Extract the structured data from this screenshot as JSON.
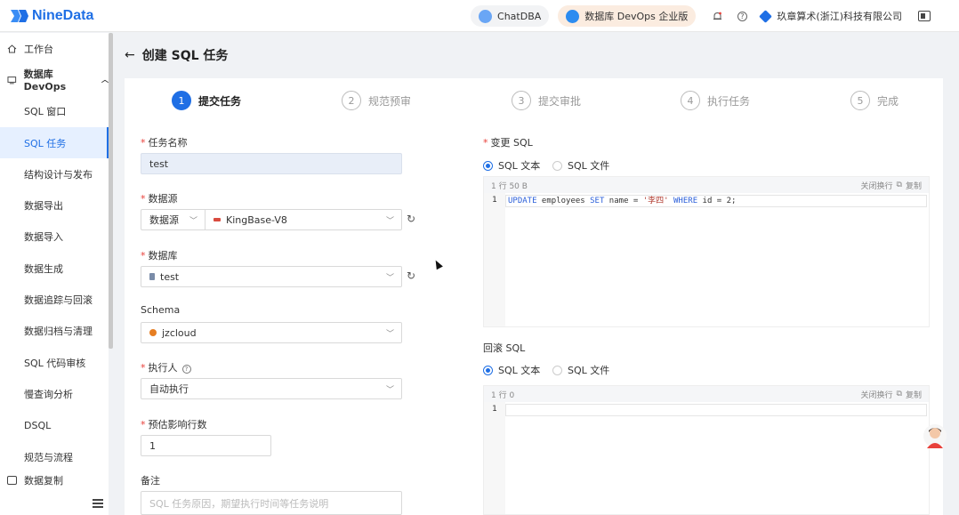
{
  "header": {
    "brand": "NineData",
    "chat_label": "ChatDBA",
    "devops_label": "数据库 DevOps 企业版",
    "company": "玖章算术(浙江)科技有限公司"
  },
  "sidebar": {
    "workspace": "工作台",
    "devops_group": "数据库 DevOps",
    "items": [
      "SQL 窗口",
      "SQL 任务",
      "结构设计与发布",
      "数据导出",
      "数据导入",
      "数据生成",
      "数据追踪与回滚",
      "数据归档与清理",
      "SQL 代码审核",
      "慢查询分析",
      "DSQL",
      "规范与流程"
    ],
    "active_index": 1,
    "truncated_group": "数据复制"
  },
  "page": {
    "title": "创建 SQL 任务"
  },
  "steps": [
    {
      "num": "1",
      "label": "提交任务"
    },
    {
      "num": "2",
      "label": "规范预审"
    },
    {
      "num": "3",
      "label": "提交审批"
    },
    {
      "num": "4",
      "label": "执行任务"
    },
    {
      "num": "5",
      "label": "完成"
    }
  ],
  "form": {
    "task_name_label": "任务名称",
    "task_name_value": "test",
    "datasource_label": "数据源",
    "datasource_type": "数据源",
    "datasource_value": "KingBase-V8",
    "database_label": "数据库",
    "database_value": "test",
    "schema_label": "Schema",
    "schema_value": "jzcloud",
    "executor_label": "执行人",
    "executor_value": "自动执行",
    "rows_label": "预估影响行数",
    "rows_value": "1",
    "note_label": "备注",
    "note_placeholder": "SQL 任务原因，期望执行时间等任务说明"
  },
  "change_sql": {
    "label": "变更 SQL",
    "radio_text": "SQL 文本",
    "radio_file": "SQL 文件",
    "meta": "1 行   50 B",
    "wrap": "关闭换行",
    "copy": "复制",
    "line_no": "1",
    "code": {
      "k1": "UPDATE",
      "t1": " employees ",
      "k2": "SET",
      "t2": " name = ",
      "s1": "'李四'",
      "t3": " ",
      "k3": "WHERE",
      "t4": " id = 2;"
    }
  },
  "rollback_sql": {
    "label": "回滚 SQL",
    "radio_text": "SQL 文本",
    "radio_file": "SQL 文件",
    "meta": "1 行   0",
    "wrap": "关闭换行",
    "copy": "复制",
    "line_no": "1"
  },
  "colors": {
    "accent": "#1f6fe5",
    "required": "#e8403a"
  }
}
